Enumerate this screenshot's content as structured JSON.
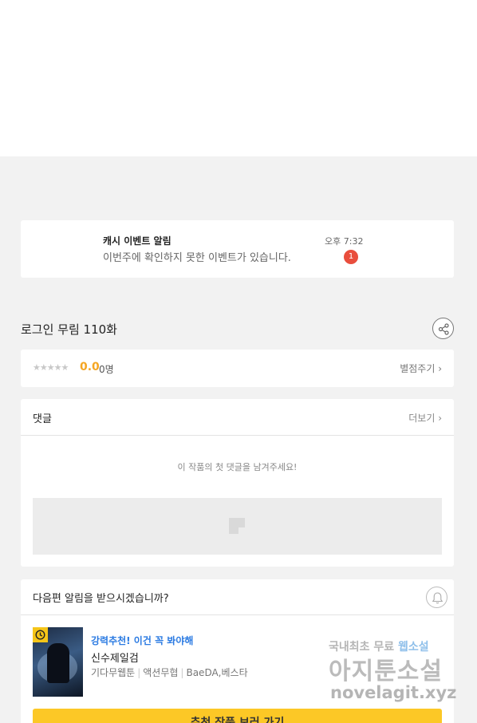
{
  "notification": {
    "title": "캐시 이벤트 알림",
    "body": "이번주에 확인하지 못한 이벤트가 있습니다.",
    "time": "오후 7:32",
    "badge": "1"
  },
  "episode": {
    "title": "로그인 무림 110화",
    "share_icon": "share-icon"
  },
  "rating": {
    "stars": "★★★★★",
    "stars_filled": 0,
    "score": "0.0",
    "count": "0명",
    "rate_link": "별점주기 ›"
  },
  "comments": {
    "title": "댓글",
    "more": "더보기 ›",
    "empty_message": "이 작품의 첫 댓글을 남겨주세요!"
  },
  "next_alert": {
    "question": "다음편 알림을 받으시겠습니까?",
    "bell_icon": "bell-icon"
  },
  "recommendation": {
    "promo": "강력추천! 이건 꼭 봐야해",
    "title": "신수제일검",
    "genre": "기다무웹툰",
    "category": "액션무협",
    "authors": "BaeDA,베스타",
    "cta": "추천 작품 보러 가기"
  },
  "watermark": {
    "line1_a": "국내최초 무료",
    "line1_b": "웹소설",
    "line2": "아지툰소설",
    "line3": "novelagit.xyz"
  },
  "colors": {
    "accent_yellow": "#fcc826",
    "score_orange": "#f5a623",
    "badge_red": "#e94e3d",
    "promo_blue": "#2a7ae2"
  }
}
